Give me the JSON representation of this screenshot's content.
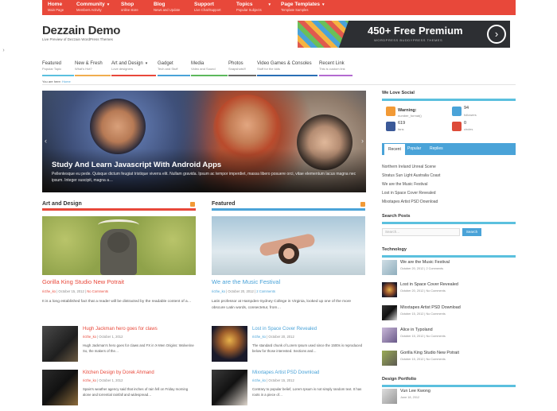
{
  "topnav": [
    {
      "title": "Home",
      "sub": "Main Page"
    },
    {
      "title": "Community",
      "sub": "Members Activity",
      "caret": "▾"
    },
    {
      "title": "Shop",
      "sub": "online store"
    },
    {
      "title": "Blog",
      "sub": "News and Update"
    },
    {
      "title": "Support",
      "sub": "Live Chat/Support"
    },
    {
      "title": "Topics",
      "sub": "Popular Subjects",
      "caret": "▾"
    },
    {
      "title": "Page Templates",
      "sub": "Template Samples",
      "caret": "▾"
    }
  ],
  "header": {
    "site_title": "Dezzain Demo",
    "tagline": "Live Preview of Dezzain WordPress Themes"
  },
  "banner": {
    "headline": "450+ Free Premium",
    "subline": "WORDPRESS BUDDYPRESS THEMES",
    "button_glyph": "›"
  },
  "side_toggle": "›",
  "categories": [
    {
      "title": "Featured",
      "sub": "Popular Topic",
      "color": "#5bc0de"
    },
    {
      "title": "New & Fresh",
      "sub": "What's Hot?",
      "color": "#f0ad4e"
    },
    {
      "title": "Art and Design",
      "sub": "Love designers",
      "caret": "▾",
      "color": "#e8483a"
    },
    {
      "title": "Gadget",
      "sub": "Tech and Stuff",
      "color": "#4aa3d8"
    },
    {
      "title": "Media",
      "sub": "Video and Sound",
      "color": "#5cb85c"
    },
    {
      "title": "Photos",
      "sub": "Snapshots!!!",
      "color": "#6b6b6b"
    },
    {
      "title": "Video Games & Consoles",
      "sub": "Stuff for the kids",
      "color": "#2a6fb5"
    },
    {
      "title": "Recent Link",
      "sub": "This is custom link",
      "color": "#b36bd1"
    }
  ],
  "breadcrumb": {
    "prefix": "You are here:",
    "current": "Home"
  },
  "slider": {
    "title": "Study And Learn Javascript With Android Apps",
    "excerpt": "Pellentesque eu pede. Quisque dictum feugiat tristique viverra elit. Nullam gravida. Ipsum ac tempor imperdiet, massa libero posuere orci, vitae elementum lacus magna nec ipsum. Integer suscipit, magna a…",
    "prev": "‹",
    "next": "›"
  },
  "art_design": {
    "heading": "Art and Design",
    "main": {
      "title": "Gorilla King Studio New Potrait",
      "author": "ricthe_ko",
      "date": "October 15, 2012",
      "comments": "No Comments",
      "excerpt": "It is a long established fact that a reader will be distracted by the readable content of a…"
    },
    "items": [
      {
        "title": "Hugh Jackman hero goes for claws",
        "author": "ricthe_ko",
        "date": "October 1, 2012",
        "excerpt": "Hugh Jackman's hero goes for claws and FX in X-Men Origins: Wolverine So, the makers of the…"
      },
      {
        "title": "Kitchen Design by Dorek Ahmand",
        "author": "ricthe_ko",
        "date": "October 1, 2012",
        "excerpt": "Spain's weather agency said that inches of rain fell on Friday morning alone and torrential rainfall and widespread…"
      }
    ]
  },
  "featured": {
    "heading": "Featured",
    "main": {
      "title": "We are the Music Festival",
      "author": "ricthe_ko",
      "date": "October 20, 2012",
      "comments": "2 Comments",
      "excerpt": "Latin professor at Hampden-Sydney College in Virginia, looked up one of the more obscure Latin words, consectetur, from…"
    },
    "items": [
      {
        "title": "Lost in Space Cover Revealed",
        "author": "ricthe_ko",
        "date": "October 20, 2012",
        "excerpt": "The standard chunk of Lorem Ipsum used since the 1500s is reproduced below for those interested. Sections and…"
      },
      {
        "title": "Mixxtapes Artist PSD Download",
        "author": "ricthe_ko",
        "date": "October 15, 2012",
        "excerpt": "Contrary to popular belief, Lorem Ipsum is not simply random text. It has roots in a piece of…"
      }
    ]
  },
  "sidebar": {
    "social_heading": "We Love Social",
    "social": [
      {
        "icon": "rss-icon",
        "value": "Warning:",
        "label": "number_format()",
        "color": "#f29a36"
      },
      {
        "icon": "twitter-icon",
        "value": "94",
        "label": "followers",
        "color": "#4aa3d8"
      },
      {
        "icon": "facebook-icon",
        "value": "619",
        "label": "fans",
        "color": "#3b5998"
      },
      {
        "icon": "googleplus-icon",
        "value": "0",
        "label": "circles",
        "color": "#dd4b39"
      }
    ],
    "tabs": [
      "Recent",
      "Popular",
      "Replies"
    ],
    "recent": [
      "Northern Ireland Unreal Scene",
      "Stratus Sun Light Australia Coast",
      "We are the Music Festival",
      "Lost in Space Cover Revealed",
      "Mixxtapes Artist PSD Download"
    ],
    "search_heading": "Search Posts",
    "search_placeholder": "Search...",
    "search_button": "Search",
    "tech_heading": "Technology",
    "tech": [
      {
        "title": "We are the Music Festival",
        "date": "October 20, 2012",
        "comments": "2 Comments"
      },
      {
        "title": "Lost in Space Cover Revealed",
        "date": "October 20, 2012",
        "comments": "No Comments"
      },
      {
        "title": "Mixxtapes Artist PSD Download",
        "date": "October 15, 2012",
        "comments": "No Comments"
      },
      {
        "title": "Alice in Typoland",
        "date": "October 15, 2012",
        "comments": "No Comments"
      },
      {
        "title": "Gorilla King Studio New Potrait",
        "date": "October 15, 2012",
        "comments": "No Comments"
      }
    ],
    "portfolio_heading": "Design Portfolio",
    "portfolio": [
      {
        "title": "Vun Lee Kwong",
        "date": "June 18, 2012"
      }
    ]
  }
}
